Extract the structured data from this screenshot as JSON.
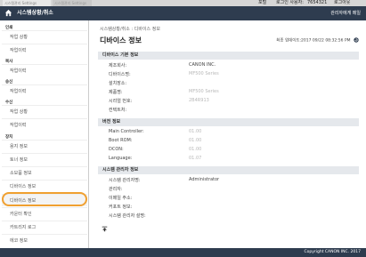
{
  "browser": {
    "tab_active": "시스템관리 Settings",
    "tab_inactive": "시스템관리 Settings",
    "menu_items": [
      "포털",
      "로그인 사용자:",
      "7654321",
      "로그아웃"
    ]
  },
  "header": {
    "title": "시스템상황/취소",
    "right_link": "관리자에게 메일"
  },
  "sidebar": {
    "categories": [
      "인쇄",
      "복사",
      "송신",
      "수신",
      "장치"
    ],
    "items": [
      "작업 상황",
      "작업이력",
      "작업이력",
      "작업이력",
      "작업 상황",
      "작업이력",
      "용지 정보",
      "토너 정보",
      "소모품 정보",
      "디바이스 정보",
      "디바이스 정보",
      "카운터 확인",
      "카트리지 로그",
      "에코 정보"
    ]
  },
  "breadcrumb": "시스템상황/취소 : 디바이스 정보",
  "page_title": "디바이스 정보",
  "updated": "최종 업데이트:2017 09/22 08:32:56 PM",
  "sections": [
    {
      "title": "디바이스 기본 정보",
      "rows": [
        {
          "label": "제조회사:",
          "value": "CANON INC."
        },
        {
          "label": "디바이스명:",
          "value": "MF500 Series"
        },
        {
          "label": "설치장소:",
          "value": ""
        },
        {
          "label": "제품명:",
          "value": "MF500 Series"
        },
        {
          "label": "시리얼 번호:",
          "value": "2B4R913"
        },
        {
          "label": "컨택트처:",
          "value": ""
        }
      ]
    },
    {
      "title": "버전 정보",
      "rows": [
        {
          "label": "Main Controller:",
          "value": "01.00"
        },
        {
          "label": "Boot ROM:",
          "value": "01.00"
        },
        {
          "label": "DCON:",
          "value": "01.00"
        },
        {
          "label": "Language:",
          "value": "01.07"
        }
      ]
    },
    {
      "title": "시스템 관리자 정보",
      "rows": [
        {
          "label": "시스템 관리자명:",
          "value": "Administrator"
        },
        {
          "label": "관리자:",
          "value": ""
        },
        {
          "label": "이메일 주소:",
          "value": ""
        },
        {
          "label": "커포트 정보:",
          "value": ""
        },
        {
          "label": "시스템 관리자 설명:",
          "value": ""
        }
      ]
    }
  ],
  "footer": {
    "copyright": "Copyright CANON INC. 2017"
  },
  "colors": {
    "header_bg": "#2e3c4f",
    "highlight": "#f0a030",
    "section_bg": "#e5e8ec"
  }
}
